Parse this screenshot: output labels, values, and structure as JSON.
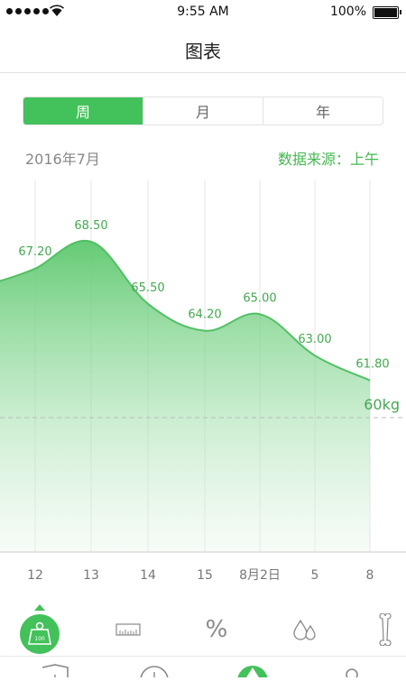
{
  "status": {
    "time": "9:55 AM",
    "battery": "100%"
  },
  "nav": {
    "title": "图表"
  },
  "tabs": [
    {
      "label": "周",
      "active": true
    },
    {
      "label": "月",
      "active": false
    },
    {
      "label": "年",
      "active": false
    }
  ],
  "date_label": "2016年7月",
  "source_label": "数据来源：上午",
  "chart_data": {
    "type": "area",
    "categories": [
      "12",
      "13",
      "14",
      "15",
      "8月2日",
      "5",
      "8"
    ],
    "values": [
      67.2,
      68.5,
      65.5,
      64.2,
      65.0,
      63.0,
      61.8
    ],
    "value_labels": [
      "67.20",
      "68.50",
      "65.50",
      "64.20",
      "65.00",
      "63.00",
      "61.80"
    ],
    "reference_line": {
      "value": 60,
      "label": "60kg"
    },
    "colors": {
      "line": "#52c064",
      "fill": "#5cc86d",
      "text": "#43a84f"
    }
  },
  "tools": [
    {
      "icon": "weight-icon",
      "badge": "100",
      "active": true
    },
    {
      "icon": "ruler-icon"
    },
    {
      "icon": "percent-icon",
      "label": "%"
    },
    {
      "icon": "water-drops-icon"
    },
    {
      "icon": "bone-icon"
    }
  ],
  "tabbar": [
    {
      "icon": "shield-icon"
    },
    {
      "icon": "clock-icon"
    },
    {
      "icon": "chart-icon",
      "active": true
    },
    {
      "icon": "person-icon"
    }
  ]
}
